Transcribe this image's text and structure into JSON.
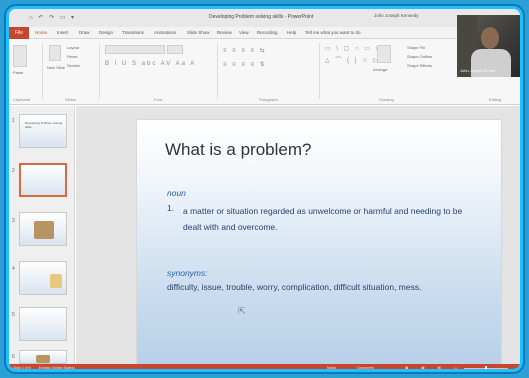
{
  "window": {
    "title": "Developing Problem solving skills - PowerPoint",
    "user": "John Joseph Kennedy",
    "quick_access": "⌂ ↶ ↷ ▭ ▾"
  },
  "ribbon": {
    "tabs": [
      "File",
      "Home",
      "Insert",
      "Draw",
      "Design",
      "Transitions",
      "Animations",
      "Slide Show",
      "Review",
      "View",
      "Recording",
      "Help",
      "Tell me what you want to do"
    ],
    "active_tab": "Home",
    "groups": {
      "clipboard": "Clipboard",
      "slides": "Slides",
      "font": "Font",
      "paragraph": "Paragraph",
      "drawing": "Drawing",
      "editing": "Editing"
    },
    "slides_buttons": {
      "new_slide": "New Slide",
      "layout": "Layout",
      "reset": "Reset",
      "section": "Section"
    },
    "paste": "Paste",
    "arrange": "Arrange",
    "quick_styles": "Quick Styles",
    "shape_fill": "Shape Fill",
    "shape_outline": "Shape Outline",
    "shape_effects": "Shape Effects",
    "font_controls": "B  I  U  S  abc  AV  Aa  A",
    "find_controls": "Find  Replace  Select"
  },
  "thumbnails": {
    "numbers": [
      "1",
      "2",
      "3",
      "4",
      "5",
      "6"
    ],
    "selected_index": 1,
    "first_title": "Developing Problem solving skills"
  },
  "slide": {
    "title": "What is a problem?",
    "noun_label": "noun",
    "def_number": "1.",
    "definition": "a matter or situation regarded as unwelcome or harmful and needing to be dealt with and overcome.",
    "synonyms_label": "synonyms:",
    "synonyms": "difficulty, issue, trouble, worry, complication, difficult situation, mess."
  },
  "status": {
    "slide_info": "Slide 2 of 6",
    "language": "English (United States)",
    "notes": "Notes",
    "comments": "Comments"
  },
  "webcam": {
    "name": "John Joseph Kenne..."
  },
  "colors": {
    "accent": "#c8462c",
    "frame": "#1ec0ff"
  }
}
